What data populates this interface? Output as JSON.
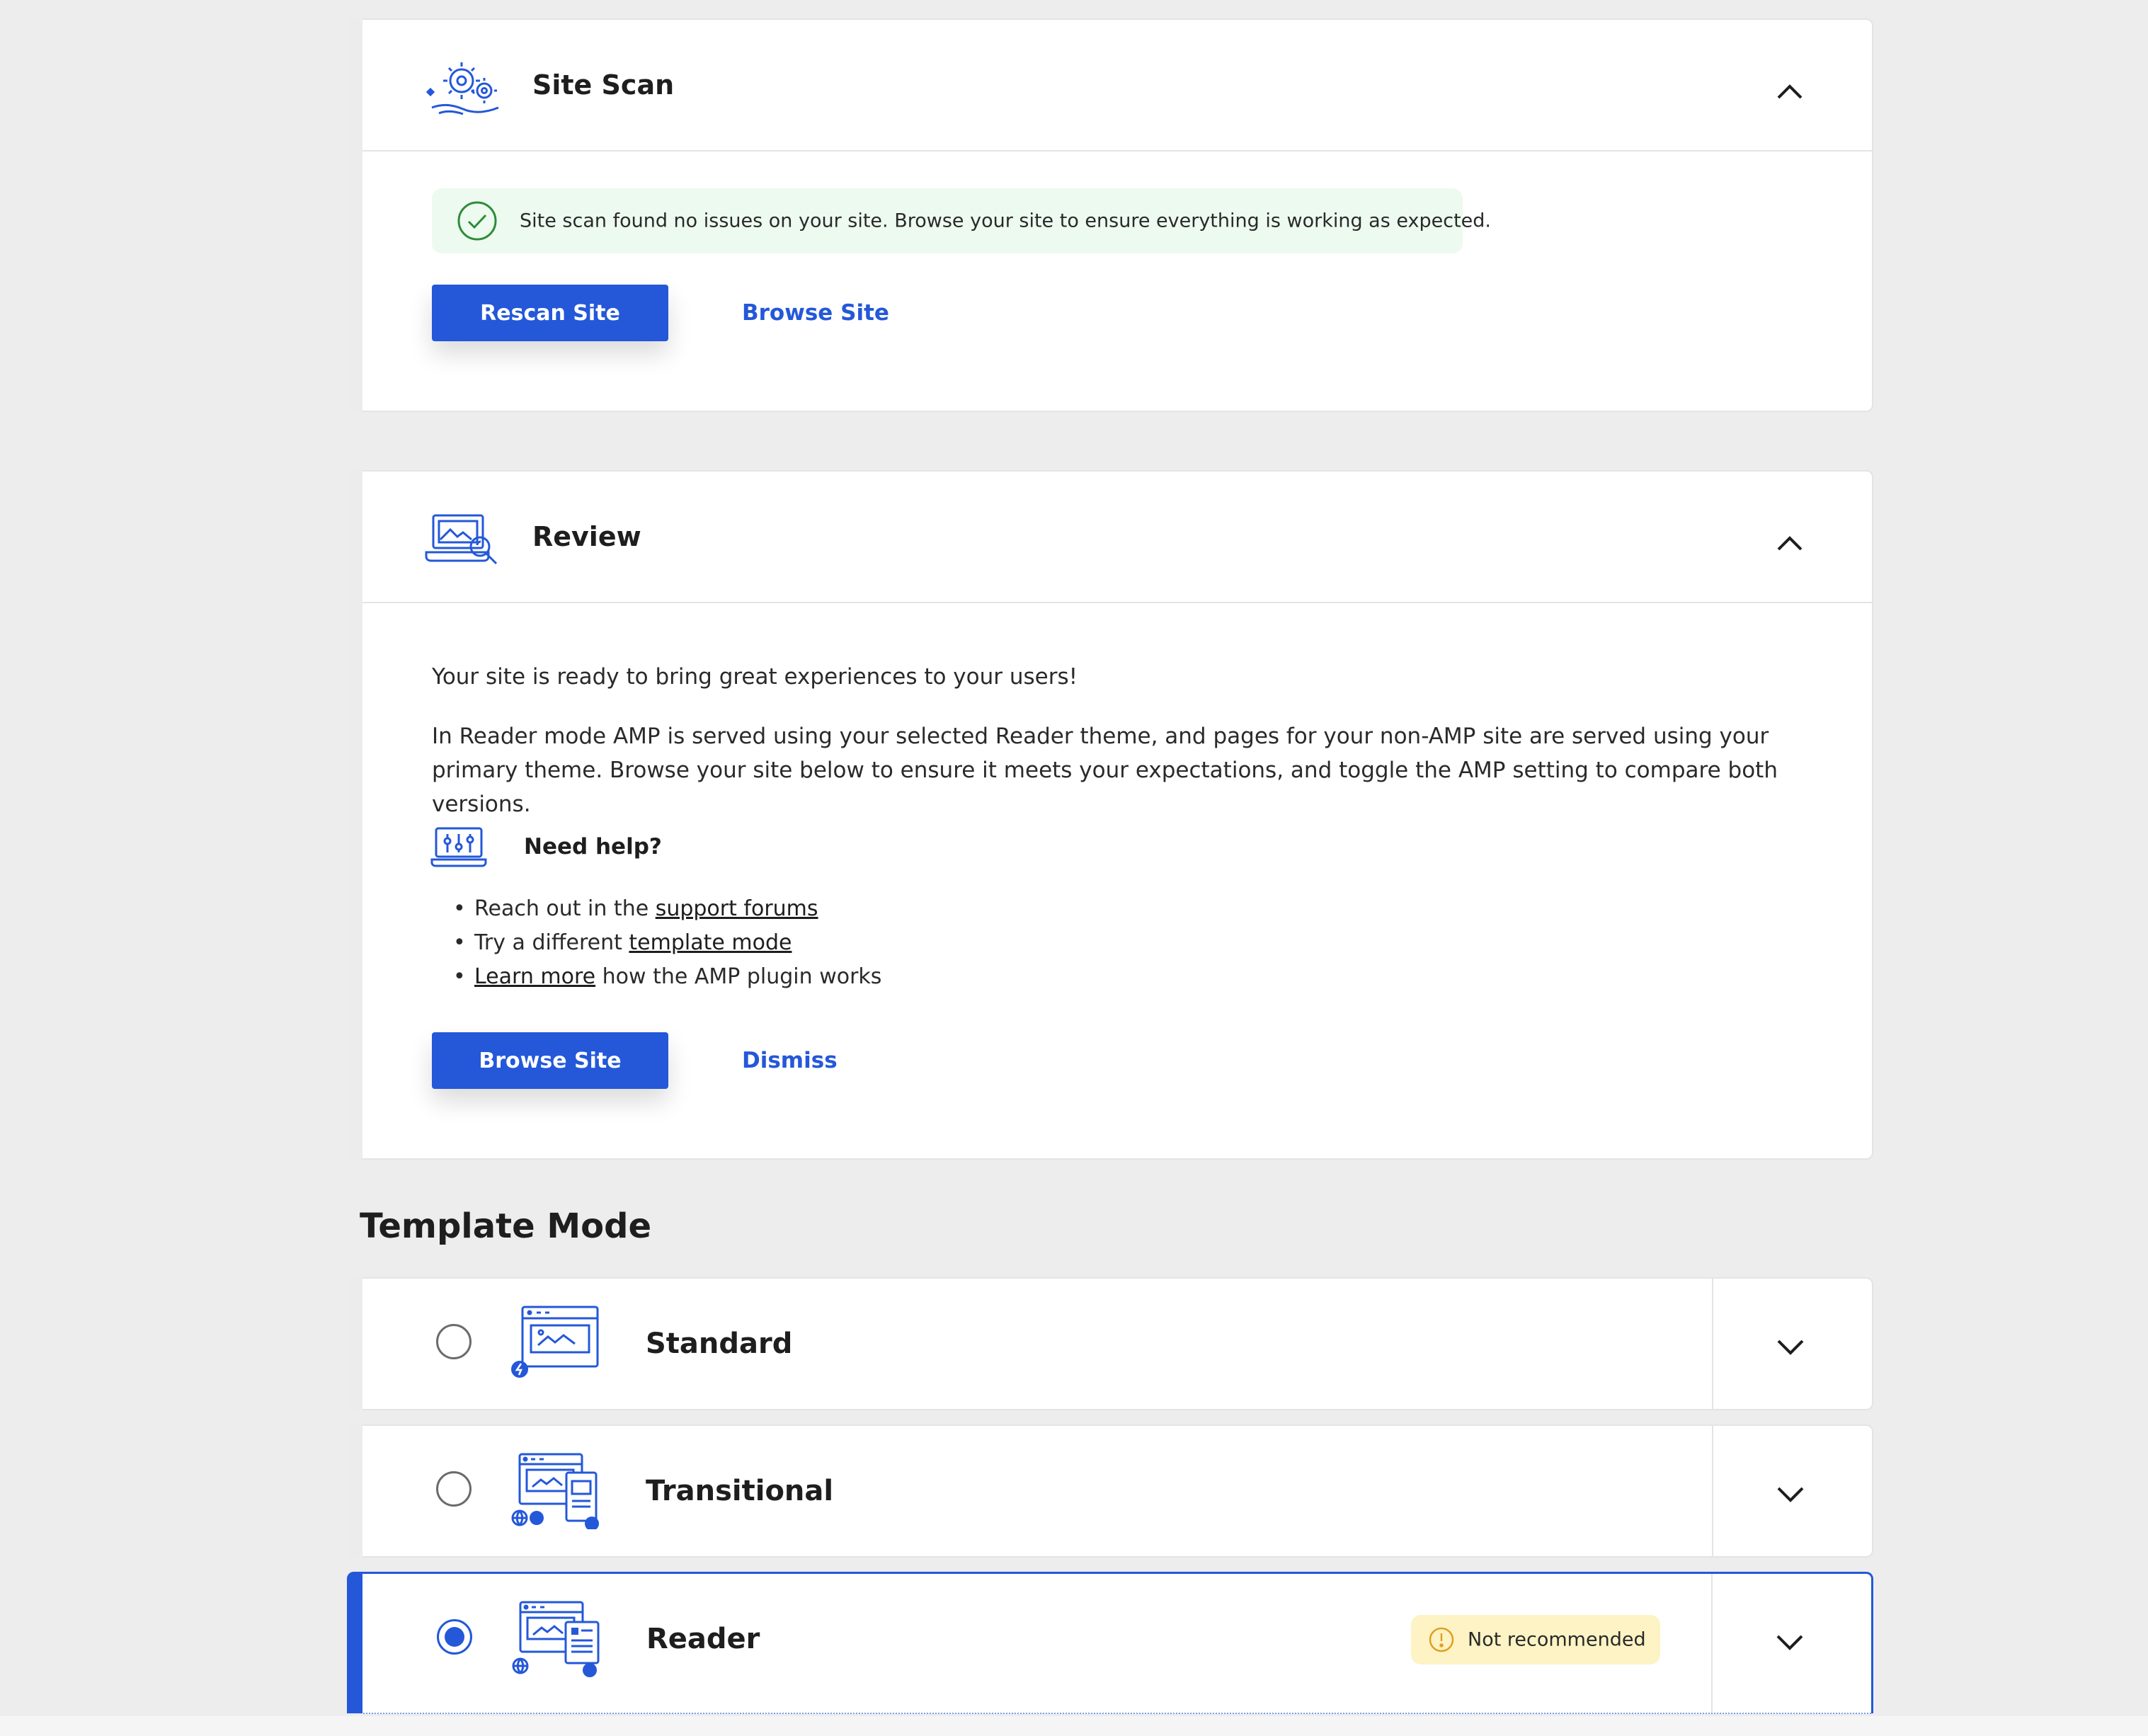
{
  "site_scan": {
    "title": "Site Scan",
    "notice": "Site scan found no issues on your site. Browse your site to ensure everything is working as expected.",
    "rescan_label": "Rescan Site",
    "browse_label": "Browse Site"
  },
  "review": {
    "title": "Review",
    "lead": "Your site is ready to bring great experiences to your users!",
    "paragraph": "In Reader mode AMP is served using your selected Reader theme, and pages for your non-AMP site are served using your primary theme. Browse your site below to ensure it meets your expectations, and toggle the AMP setting to compare both versions.",
    "help_title": "Need help?",
    "help_items": [
      {
        "prefix": "Reach out in the ",
        "link": "support forums",
        "suffix": ""
      },
      {
        "prefix": "Try a different ",
        "link": "template mode",
        "suffix": ""
      },
      {
        "prefix": "",
        "link": "Learn more",
        "suffix": " how the AMP plugin works"
      }
    ],
    "browse_label": "Browse Site",
    "dismiss_label": "Dismiss"
  },
  "template_mode": {
    "title": "Template Mode",
    "modes": [
      {
        "label": "Standard",
        "selected": false
      },
      {
        "label": "Transitional",
        "selected": false
      },
      {
        "label": "Reader",
        "selected": true,
        "badge": "Not recommended"
      }
    ]
  },
  "colors": {
    "primary": "#2458d9",
    "success_bg": "#edfaef",
    "success_icon": "#2e8b3a",
    "warning_bg": "#fdf3c4",
    "warning_icon": "#e0a020"
  }
}
